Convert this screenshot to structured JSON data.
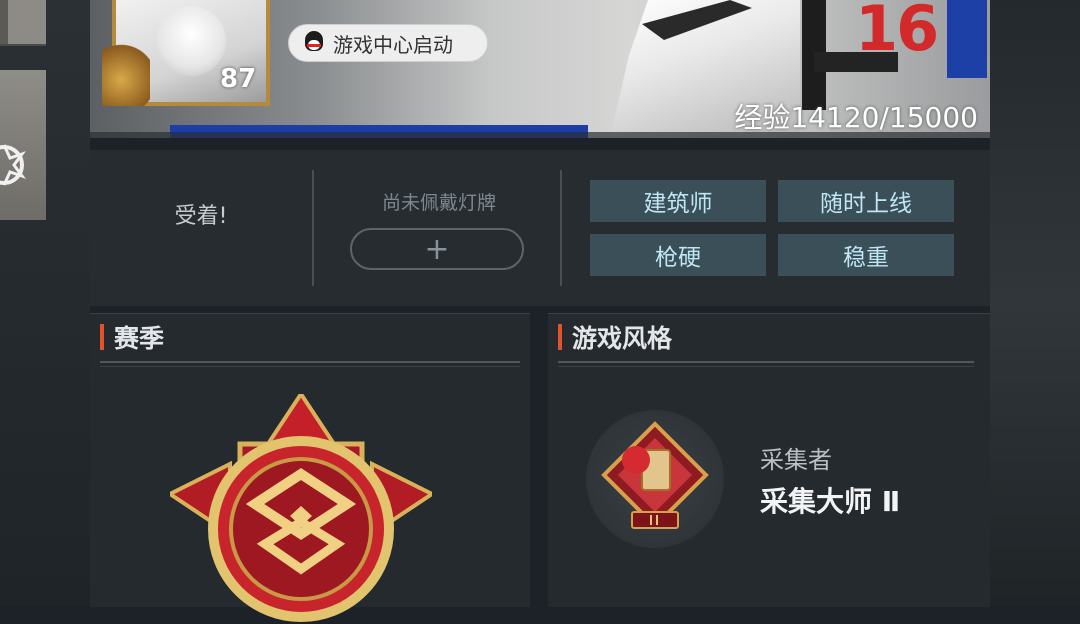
{
  "banner": {
    "launch_label": "游戏中心启动",
    "level": "87",
    "exp_label": "经验14120/15000",
    "logo_text": "16"
  },
  "info": {
    "motto": "受着!",
    "plate_label": "尚未佩戴灯牌",
    "plate_add": "+",
    "tags": [
      "建筑师",
      "随时上线",
      "枪硬",
      "稳重"
    ]
  },
  "season": {
    "title": "赛季"
  },
  "style": {
    "title": "游戏风格",
    "sub": "采集者",
    "main": "采集大师 Ⅱ"
  },
  "icons": {
    "qq": "qq-penguin-icon",
    "season_badge": "season-rank-badge-icon",
    "style_badge": "gatherer-badge-icon"
  },
  "colors": {
    "accent": "#e2522c",
    "tag_bg": "#3a4f58",
    "tag_text": "#bfe6f2",
    "badge_red": "#c4202a",
    "badge_gold": "#d8b25a"
  }
}
